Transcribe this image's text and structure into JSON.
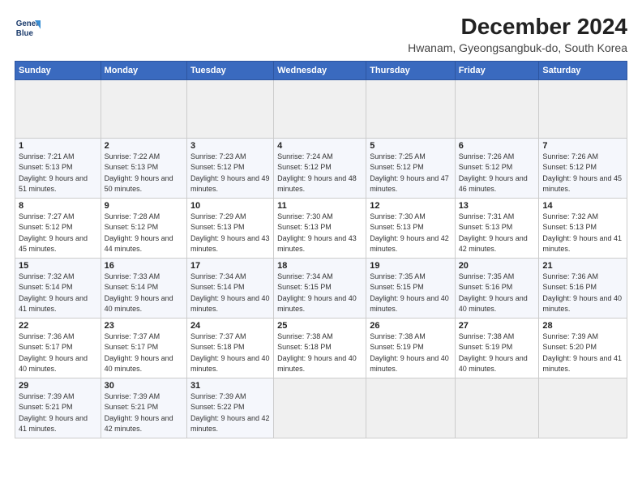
{
  "header": {
    "logo_line1": "General",
    "logo_line2": "Blue",
    "main_title": "December 2024",
    "subtitle": "Hwanam, Gyeongsangbuk-do, South Korea"
  },
  "calendar": {
    "days_of_week": [
      "Sunday",
      "Monday",
      "Tuesday",
      "Wednesday",
      "Thursday",
      "Friday",
      "Saturday"
    ],
    "weeks": [
      [
        {
          "day": "",
          "empty": true
        },
        {
          "day": "",
          "empty": true
        },
        {
          "day": "",
          "empty": true
        },
        {
          "day": "",
          "empty": true
        },
        {
          "day": "",
          "empty": true
        },
        {
          "day": "",
          "empty": true
        },
        {
          "day": "",
          "empty": true
        }
      ],
      [
        {
          "day": "1",
          "sunrise": "7:21 AM",
          "sunset": "5:13 PM",
          "daylight": "9 hours and 51 minutes."
        },
        {
          "day": "2",
          "sunrise": "7:22 AM",
          "sunset": "5:13 PM",
          "daylight": "9 hours and 50 minutes."
        },
        {
          "day": "3",
          "sunrise": "7:23 AM",
          "sunset": "5:12 PM",
          "daylight": "9 hours and 49 minutes."
        },
        {
          "day": "4",
          "sunrise": "7:24 AM",
          "sunset": "5:12 PM",
          "daylight": "9 hours and 48 minutes."
        },
        {
          "day": "5",
          "sunrise": "7:25 AM",
          "sunset": "5:12 PM",
          "daylight": "9 hours and 47 minutes."
        },
        {
          "day": "6",
          "sunrise": "7:26 AM",
          "sunset": "5:12 PM",
          "daylight": "9 hours and 46 minutes."
        },
        {
          "day": "7",
          "sunrise": "7:26 AM",
          "sunset": "5:12 PM",
          "daylight": "9 hours and 45 minutes."
        }
      ],
      [
        {
          "day": "8",
          "sunrise": "7:27 AM",
          "sunset": "5:12 PM",
          "daylight": "9 hours and 45 minutes."
        },
        {
          "day": "9",
          "sunrise": "7:28 AM",
          "sunset": "5:12 PM",
          "daylight": "9 hours and 44 minutes."
        },
        {
          "day": "10",
          "sunrise": "7:29 AM",
          "sunset": "5:13 PM",
          "daylight": "9 hours and 43 minutes."
        },
        {
          "day": "11",
          "sunrise": "7:30 AM",
          "sunset": "5:13 PM",
          "daylight": "9 hours and 43 minutes."
        },
        {
          "day": "12",
          "sunrise": "7:30 AM",
          "sunset": "5:13 PM",
          "daylight": "9 hours and 42 minutes."
        },
        {
          "day": "13",
          "sunrise": "7:31 AM",
          "sunset": "5:13 PM",
          "daylight": "9 hours and 42 minutes."
        },
        {
          "day": "14",
          "sunrise": "7:32 AM",
          "sunset": "5:13 PM",
          "daylight": "9 hours and 41 minutes."
        }
      ],
      [
        {
          "day": "15",
          "sunrise": "7:32 AM",
          "sunset": "5:14 PM",
          "daylight": "9 hours and 41 minutes."
        },
        {
          "day": "16",
          "sunrise": "7:33 AM",
          "sunset": "5:14 PM",
          "daylight": "9 hours and 40 minutes."
        },
        {
          "day": "17",
          "sunrise": "7:34 AM",
          "sunset": "5:14 PM",
          "daylight": "9 hours and 40 minutes."
        },
        {
          "day": "18",
          "sunrise": "7:34 AM",
          "sunset": "5:15 PM",
          "daylight": "9 hours and 40 minutes."
        },
        {
          "day": "19",
          "sunrise": "7:35 AM",
          "sunset": "5:15 PM",
          "daylight": "9 hours and 40 minutes."
        },
        {
          "day": "20",
          "sunrise": "7:35 AM",
          "sunset": "5:16 PM",
          "daylight": "9 hours and 40 minutes."
        },
        {
          "day": "21",
          "sunrise": "7:36 AM",
          "sunset": "5:16 PM",
          "daylight": "9 hours and 40 minutes."
        }
      ],
      [
        {
          "day": "22",
          "sunrise": "7:36 AM",
          "sunset": "5:17 PM",
          "daylight": "9 hours and 40 minutes."
        },
        {
          "day": "23",
          "sunrise": "7:37 AM",
          "sunset": "5:17 PM",
          "daylight": "9 hours and 40 minutes."
        },
        {
          "day": "24",
          "sunrise": "7:37 AM",
          "sunset": "5:18 PM",
          "daylight": "9 hours and 40 minutes."
        },
        {
          "day": "25",
          "sunrise": "7:38 AM",
          "sunset": "5:18 PM",
          "daylight": "9 hours and 40 minutes."
        },
        {
          "day": "26",
          "sunrise": "7:38 AM",
          "sunset": "5:19 PM",
          "daylight": "9 hours and 40 minutes."
        },
        {
          "day": "27",
          "sunrise": "7:38 AM",
          "sunset": "5:19 PM",
          "daylight": "9 hours and 40 minutes."
        },
        {
          "day": "28",
          "sunrise": "7:39 AM",
          "sunset": "5:20 PM",
          "daylight": "9 hours and 41 minutes."
        }
      ],
      [
        {
          "day": "29",
          "sunrise": "7:39 AM",
          "sunset": "5:21 PM",
          "daylight": "9 hours and 41 minutes."
        },
        {
          "day": "30",
          "sunrise": "7:39 AM",
          "sunset": "5:21 PM",
          "daylight": "9 hours and 42 minutes."
        },
        {
          "day": "31",
          "sunrise": "7:39 AM",
          "sunset": "5:22 PM",
          "daylight": "9 hours and 42 minutes."
        },
        {
          "day": "",
          "empty": true
        },
        {
          "day": "",
          "empty": true
        },
        {
          "day": "",
          "empty": true
        },
        {
          "day": "",
          "empty": true
        }
      ]
    ],
    "labels": {
      "sunrise": "Sunrise:",
      "sunset": "Sunset:",
      "daylight": "Daylight:"
    }
  }
}
